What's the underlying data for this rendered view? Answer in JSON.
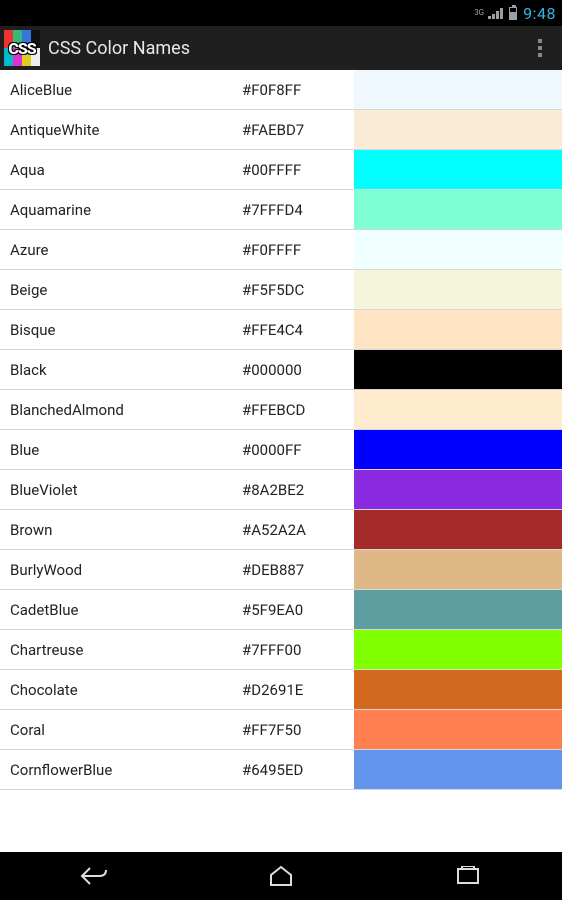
{
  "status_bar": {
    "network_type": "3G",
    "time": "9:48"
  },
  "action_bar": {
    "title": "CSS Color Names",
    "app_icon_text": "CSS"
  },
  "colors": [
    {
      "name": "AliceBlue",
      "hex": "#F0F8FF"
    },
    {
      "name": "AntiqueWhite",
      "hex": "#FAEBD7"
    },
    {
      "name": "Aqua",
      "hex": "#00FFFF"
    },
    {
      "name": "Aquamarine",
      "hex": "#7FFFD4"
    },
    {
      "name": "Azure",
      "hex": "#F0FFFF"
    },
    {
      "name": "Beige",
      "hex": "#F5F5DC"
    },
    {
      "name": "Bisque",
      "hex": "#FFE4C4"
    },
    {
      "name": "Black",
      "hex": "#000000"
    },
    {
      "name": "BlanchedAlmond",
      "hex": "#FFEBCD"
    },
    {
      "name": "Blue",
      "hex": "#0000FF"
    },
    {
      "name": "BlueViolet",
      "hex": "#8A2BE2"
    },
    {
      "name": "Brown",
      "hex": "#A52A2A"
    },
    {
      "name": "BurlyWood",
      "hex": "#DEB887"
    },
    {
      "name": "CadetBlue",
      "hex": "#5F9EA0"
    },
    {
      "name": "Chartreuse",
      "hex": "#7FFF00"
    },
    {
      "name": "Chocolate",
      "hex": "#D2691E"
    },
    {
      "name": "Coral",
      "hex": "#FF7F50"
    },
    {
      "name": "CornflowerBlue",
      "hex": "#6495ED"
    }
  ]
}
